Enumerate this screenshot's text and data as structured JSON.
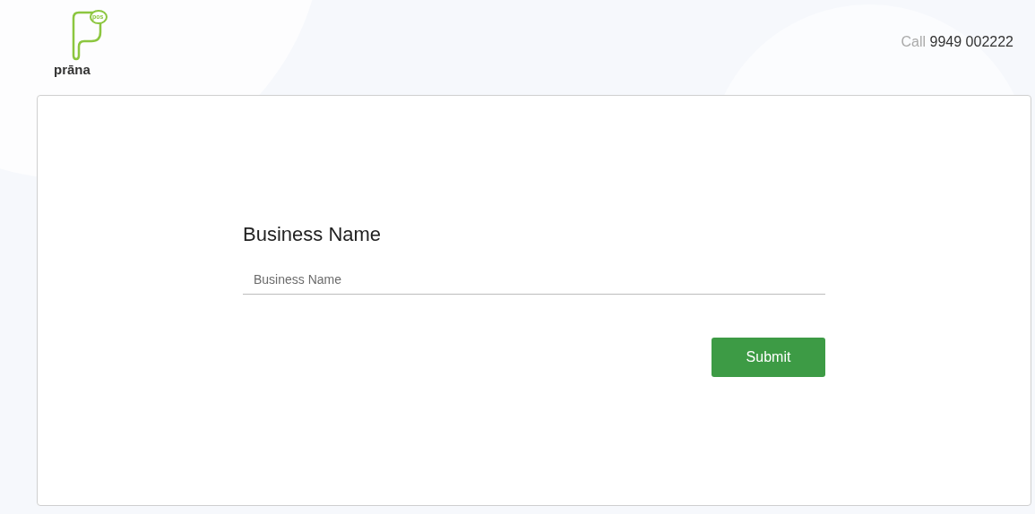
{
  "logo": {
    "badge": "pos",
    "name": "prāna"
  },
  "contact": {
    "label": "Call",
    "phone": "9949 002222"
  },
  "form": {
    "title": "Business Name",
    "field": {
      "placeholder": "Business Name"
    },
    "submit": "Submit"
  }
}
